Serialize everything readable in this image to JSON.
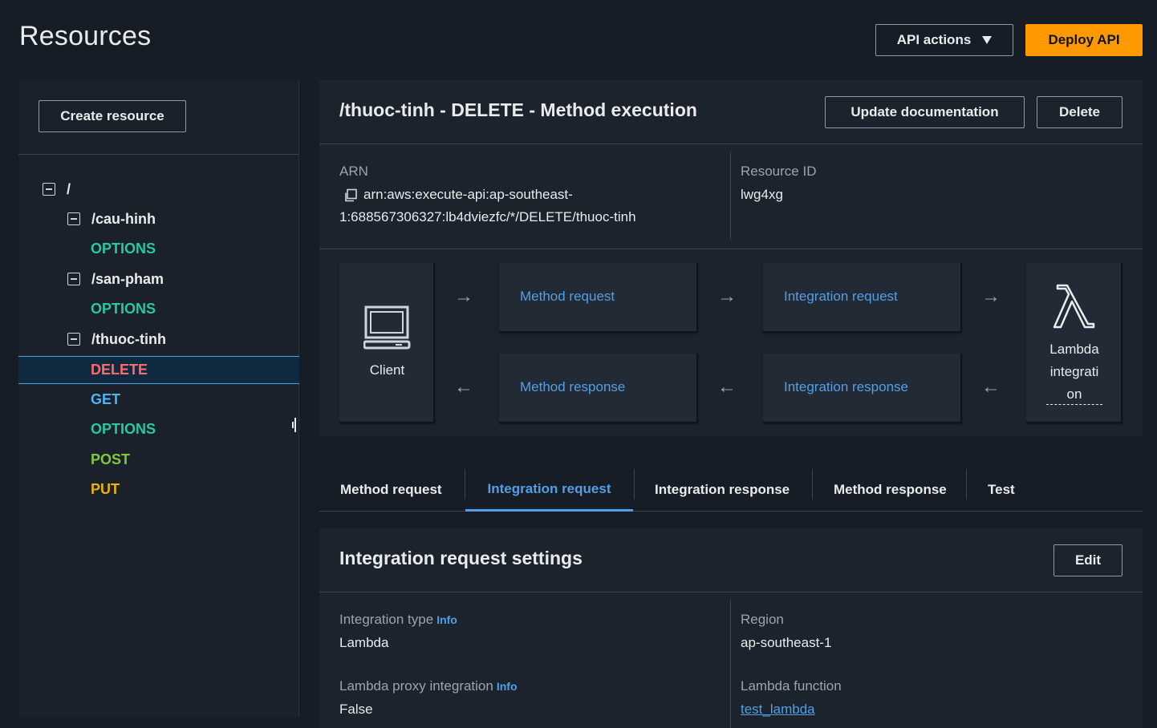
{
  "page": {
    "title": "Resources"
  },
  "toolbar": {
    "api_actions_label": "API actions",
    "deploy_label": "Deploy API"
  },
  "sidebar": {
    "create_label": "Create resource",
    "tree": [
      {
        "kind": "path",
        "label": "/"
      },
      {
        "kind": "path",
        "label": "/cau-hinh"
      },
      {
        "kind": "method",
        "label": "OPTIONS"
      },
      {
        "kind": "path",
        "label": "/san-pham"
      },
      {
        "kind": "method",
        "label": "OPTIONS"
      },
      {
        "kind": "path",
        "label": "/thuoc-tinh"
      },
      {
        "kind": "method",
        "label": "DELETE",
        "selected": true
      },
      {
        "kind": "method",
        "label": "GET"
      },
      {
        "kind": "method",
        "label": "OPTIONS"
      },
      {
        "kind": "method",
        "label": "POST"
      },
      {
        "kind": "method",
        "label": "PUT"
      }
    ]
  },
  "method_panel": {
    "title": "/thuoc-tinh - DELETE - Method execution",
    "update_doc_label": "Update documentation",
    "delete_label": "Delete",
    "arn_label": "ARN",
    "arn_value_line1": "arn:aws:execute-api:ap-southeast-",
    "arn_value_line2": "1:688567306327:lb4dviezfc/*/DELETE/thuoc-tinh",
    "resource_id_label": "Resource ID",
    "resource_id_value": "lwg4xg"
  },
  "flow": {
    "client_label": "Client",
    "method_request": "Method request",
    "integration_request": "Integration request",
    "method_response": "Method response",
    "integration_response": "Integration response",
    "lambda_line1": "Lambda",
    "lambda_line2": "integrati",
    "lambda_line3": "on",
    "arrow_right": "→",
    "arrow_left": "←"
  },
  "tabs": [
    "Method request",
    "Integration request",
    "Integration response",
    "Method response",
    "Test"
  ],
  "active_tab": "Integration request",
  "settings": {
    "title": "Integration request settings",
    "edit_label": "Edit",
    "integration_type_label": "Integration type",
    "integration_type_value": "Lambda",
    "proxy_label": "Lambda proxy integration",
    "proxy_value": "False",
    "region_label": "Region",
    "region_value": "ap-southeast-1",
    "function_label": "Lambda function",
    "function_value": "test_lambda",
    "info_label": "Info"
  },
  "colors": {
    "accent": "#539fe5",
    "primary_button": "#ff9900",
    "options": "#29c7a4",
    "delete": "#ff6b6b",
    "get": "#4fb2f5",
    "post": "#7fca3a",
    "put": "#eab308"
  }
}
